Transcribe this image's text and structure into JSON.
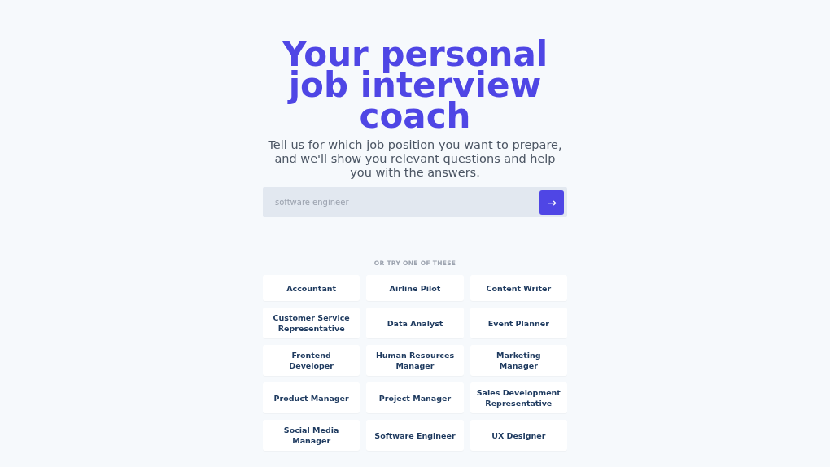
{
  "hero": {
    "title": "Your personal job interview coach",
    "subtitle": "Tell us for which job position you want to prepare, and we'll show you relevant questions and help you with the answers."
  },
  "search": {
    "placeholder": "software engineer",
    "button": "→"
  },
  "suggestions": {
    "heading": "OR TRY ONE OF THESE",
    "items": [
      {
        "label": "Accountant"
      },
      {
        "label": "Airline Pilot"
      },
      {
        "label": "Content Writer"
      },
      {
        "label": "Customer Service Representative"
      },
      {
        "label": "Data Analyst"
      },
      {
        "label": "Event Planner"
      },
      {
        "label": "Frontend Developer"
      },
      {
        "label": "Human Resources Manager"
      },
      {
        "label": "Marketing Manager"
      },
      {
        "label": "Product Manager"
      },
      {
        "label": "Project Manager"
      },
      {
        "label": "Sales Development Representative"
      },
      {
        "label": "Social Media Manager"
      },
      {
        "label": "Software Engineer"
      },
      {
        "label": "UX Designer"
      }
    ]
  }
}
